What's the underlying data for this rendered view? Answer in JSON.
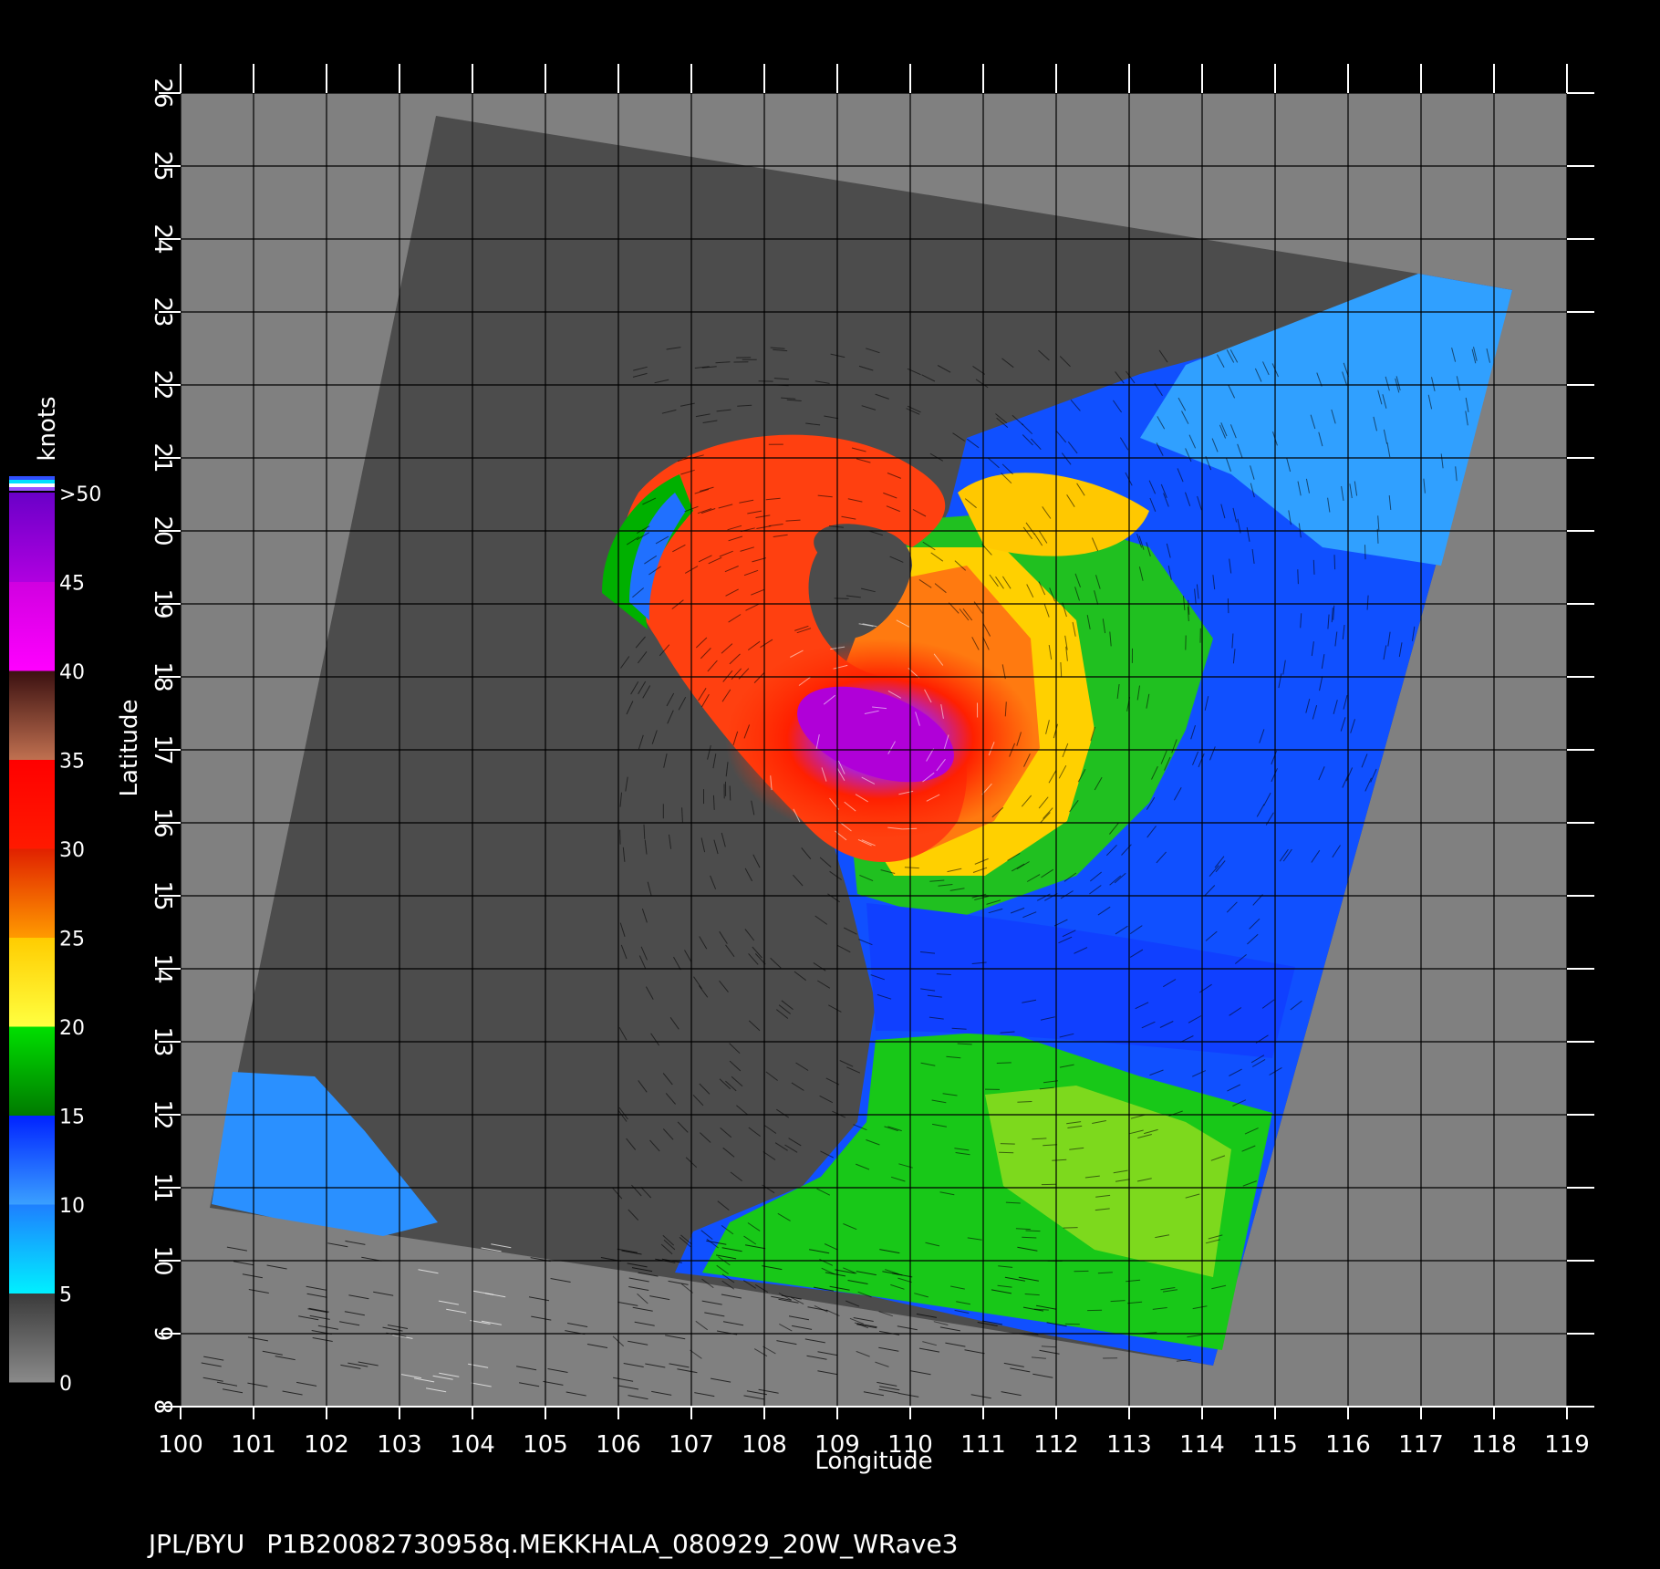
{
  "colors": {
    "background": "#000000",
    "plot_background": "#808080",
    "swath": "#4c4c4c",
    "grid": "#000000",
    "axis": "#ffffff"
  },
  "axes": {
    "xlabel": "Longitude",
    "ylabel": "Latitude",
    "x_ticks": [
      "100",
      "101",
      "102",
      "103",
      "104",
      "105",
      "106",
      "107",
      "108",
      "109",
      "110",
      "111",
      "112",
      "113",
      "114",
      "115",
      "116",
      "117",
      "118",
      "119"
    ],
    "y_ticks": [
      "8",
      "9",
      "10",
      "11",
      "12",
      "13",
      "14",
      "15",
      "16",
      "17",
      "18",
      "19",
      "20",
      "21",
      "22",
      "23",
      "24",
      "25",
      "26"
    ],
    "xlim": [
      100,
      119
    ],
    "ylim": [
      8,
      26
    ]
  },
  "colorbar": {
    "title": "knots",
    "labels": [
      "0",
      "5",
      "10",
      "15",
      "20",
      "25",
      "30",
      "35",
      "40",
      "45",
      ">50"
    ],
    "bands": [
      {
        "from": 0,
        "to": 5,
        "top": "#3a3a3a",
        "bottom": "#8a8a8a"
      },
      {
        "from": 5,
        "to": 10,
        "top": "#1e7fff",
        "bottom": "#00f0ff"
      },
      {
        "from": 10,
        "to": 15,
        "top": "#0022ff",
        "bottom": "#3aa0ff"
      },
      {
        "from": 15,
        "to": 20,
        "top": "#00e000",
        "bottom": "#007a00"
      },
      {
        "from": 20,
        "to": 25,
        "top": "#ffcc00",
        "bottom": "#ffff40"
      },
      {
        "from": 25,
        "to": 30,
        "top": "#e02000",
        "bottom": "#ff9a00"
      },
      {
        "from": 30,
        "to": 35,
        "top": "#ff0000",
        "bottom": "#ff1a00"
      },
      {
        "from": 35,
        "to": 40,
        "top": "#3a1010",
        "bottom": "#c07050"
      },
      {
        "from": 40,
        "to": 45,
        "top": "#d000e0",
        "bottom": "#ff00ff"
      },
      {
        "from": 45,
        "to": 50,
        "top": "#6a00c8",
        "bottom": "#b000e0"
      }
    ],
    "cap_colors": [
      "#3050ff",
      "#00e0ff",
      "#ffffff",
      "#9a50ff"
    ]
  },
  "footer": {
    "source": "JPL/BYU",
    "filename": "P1B20082730958q.MEKKHALA_080929_20W_WRave3"
  }
}
